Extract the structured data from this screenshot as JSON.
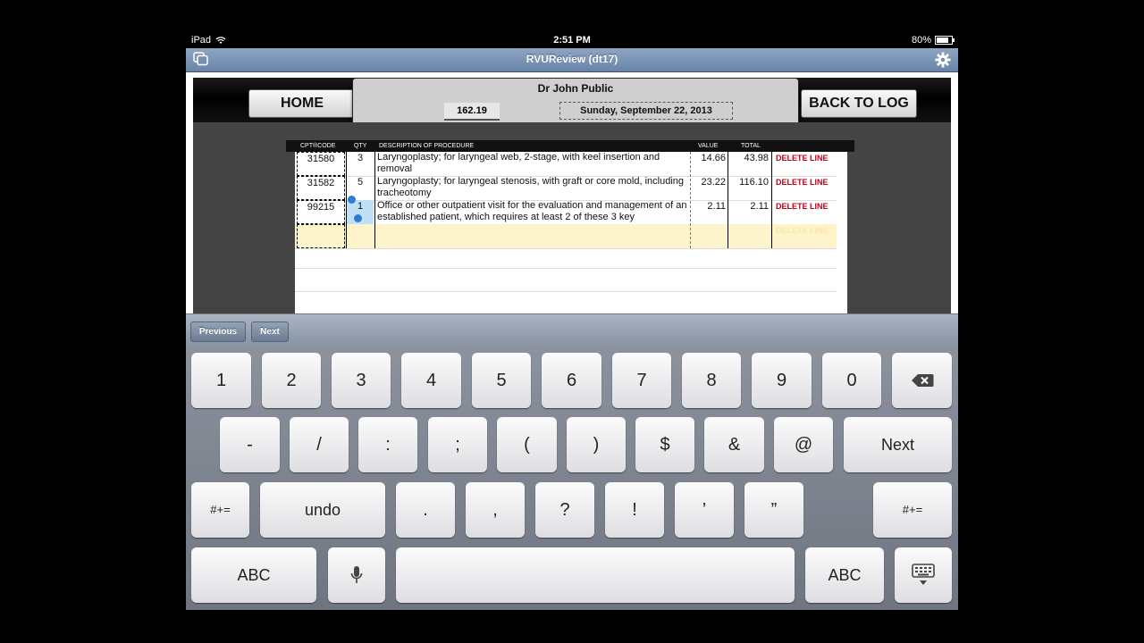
{
  "status_bar": {
    "device": "iPad",
    "time": "2:51 PM",
    "battery": "80%",
    "battery_level": 0.8,
    "wifi_icon": "wifi-icon"
  },
  "nav": {
    "title": "RVUReview (dt17)",
    "left_icon": "copy-icon",
    "right_icon": "gear-icon"
  },
  "header": {
    "home_label": "HOME",
    "back_label": "BACK TO LOG",
    "doctor": "Dr John Public",
    "rvu_total": "162.19",
    "date": "Sunday, September 22, 2013"
  },
  "table": {
    "columns": {
      "code": "CPT®CODE",
      "qty": "QTY",
      "desc": "DESCRIPTION OF PROCEDURE",
      "value": "VALUE",
      "total": "TOTAL"
    },
    "rows": [
      {
        "code": "31580",
        "qty": "3",
        "desc": "Laryngoplasty; for laryngeal web, 2-stage, with keel insertion and removal",
        "value": "14.66",
        "total": "43.98",
        "delete": "DELETE LINE"
      },
      {
        "code": "31582",
        "qty": "5",
        "desc": "Laryngoplasty; for laryngeal stenosis, with graft or core mold, including tracheotomy",
        "value": "23.22",
        "total": "116.10",
        "delete": "DELETE LINE"
      },
      {
        "code": "99215",
        "qty": "1",
        "desc": "Office or other outpatient visit for the evaluation and management of an established patient, which requires at least 2 of these 3 key",
        "value": "2.11",
        "total": "2.11",
        "delete": "DELETE LINE"
      }
    ],
    "new_row_delete": "DELETE LINE"
  },
  "accessory": {
    "previous": "Previous",
    "next": "Next"
  },
  "keyboard": {
    "row1": [
      "1",
      "2",
      "3",
      "4",
      "5",
      "6",
      "7",
      "8",
      "9",
      "0"
    ],
    "row2": [
      "-",
      "/",
      ":",
      ";",
      "(",
      ")",
      "$",
      "&",
      "@"
    ],
    "row2_next": "Next",
    "row3_left": "#+=",
    "row3_undo": "undo",
    "row3": [
      ".",
      ",",
      "?",
      "!",
      "’",
      "”"
    ],
    "row3_right": "#+=",
    "abc_left": "ABC",
    "abc_right": "ABC",
    "backspace_icon": "backspace-icon",
    "mic_icon": "microphone-icon",
    "hide_icon": "keyboard-hide-icon"
  }
}
